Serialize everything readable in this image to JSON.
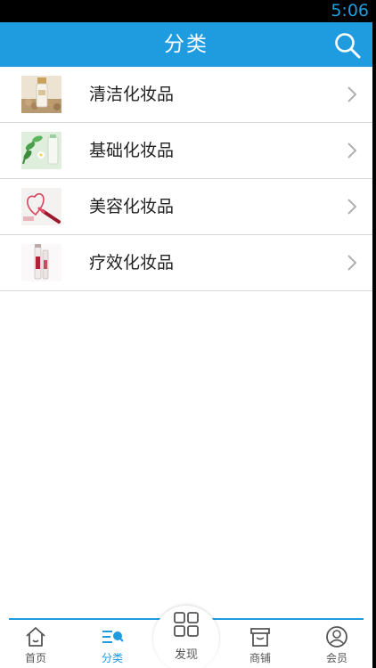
{
  "status_bar": {
    "time": "5:06"
  },
  "header": {
    "title": "分类",
    "search_icon": "search-icon"
  },
  "categories": [
    {
      "label": "清洁化妆品",
      "thumb": "cleansing-product-image"
    },
    {
      "label": "基础化妆品",
      "thumb": "basic-care-product-image"
    },
    {
      "label": "美容化妆品",
      "thumb": "beauty-product-image"
    },
    {
      "label": "疗效化妆品",
      "thumb": "therapeutic-product-image"
    }
  ],
  "bottom_nav": {
    "items": [
      {
        "label": "首页",
        "icon": "home-icon",
        "active": false
      },
      {
        "label": "分类",
        "icon": "category-icon",
        "active": true
      },
      {
        "label": "发现",
        "icon": "grid-icon",
        "active": false
      },
      {
        "label": "商铺",
        "icon": "shop-icon",
        "active": false
      },
      {
        "label": "会员",
        "icon": "user-icon",
        "active": false
      }
    ]
  },
  "colors": {
    "accent": "#1f9be0",
    "background": "#ffffff",
    "divider": "#d8d8d8",
    "text": "#222222",
    "nav_text": "#555555"
  }
}
